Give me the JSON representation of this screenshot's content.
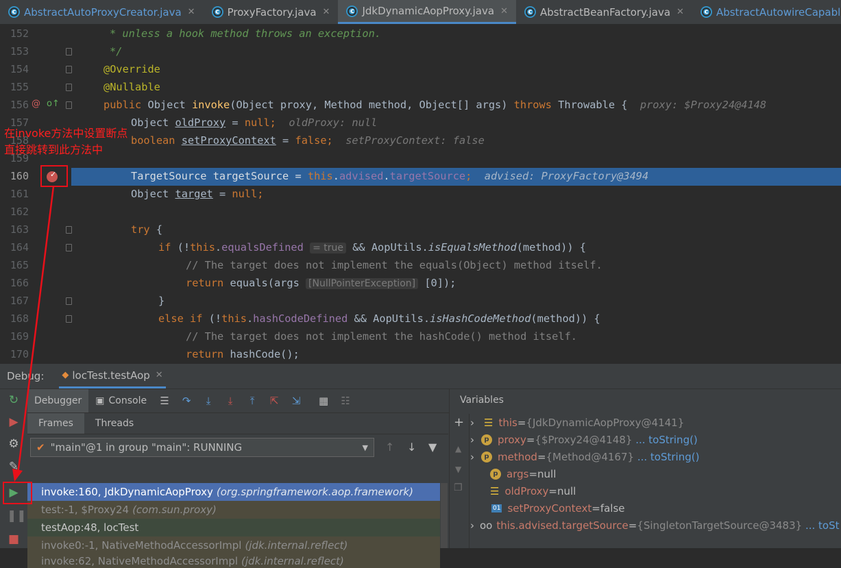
{
  "tabs": [
    {
      "label": "AbstractAutoProxyCreator.java",
      "active": false
    },
    {
      "label": "ProxyFactory.java",
      "active": false
    },
    {
      "label": "JdkDynamicAopProxy.java",
      "active": true
    },
    {
      "label": "AbstractBeanFactory.java",
      "active": false
    },
    {
      "label": "AbstractAutowireCapableBea",
      "active": false
    }
  ],
  "editor": {
    "line_numbers": [
      "152",
      "153",
      "154",
      "155",
      "156",
      "157",
      "158",
      "159",
      "160",
      "161",
      "162",
      "163",
      "164",
      "165",
      "166",
      "167",
      "168",
      "169",
      "170"
    ],
    "current_line": "160",
    "l152": "* unless a hook method throws an exception.",
    "l153": "*/",
    "l154": "@Override",
    "l155": "@Nullable",
    "l156_public": "public",
    "l156_obj": "Object",
    "l156_invoke": "invoke",
    "l156_params": "(Object proxy, Method method, Object[] args)",
    "l156_throws": "throws",
    "l156_throwable": "Throwable {",
    "l156_hint": "proxy: $Proxy24@4148",
    "l157_type": "Object",
    "l157_var": "oldProxy",
    "l157_eq": "=",
    "l157_null": "null",
    "l157_hint": "oldProxy: null",
    "l158_type": "boolean",
    "l158_var": "setProxyContext",
    "l158_false": "false",
    "l158_hint": "setProxyContext: false",
    "l160_a": "TargetSource targetSource = ",
    "l160_this": "this",
    "l160_advised": "advised",
    "l160_ts": "targetSource",
    "l160_hint": "advised: ProxyFactory@3494",
    "l161_type": "Object",
    "l161_var": "target",
    "l161_null": "null",
    "l163_try": "try",
    "l164_if": "if",
    "l164_this": "this",
    "l164_field": "equalsDefined",
    "l164_badge": "= true",
    "l164_rest": "&& AopUtils.",
    "l164_method": "isEqualsMethod",
    "l164_end": "(method)) {",
    "l165": "// The target does not implement the equals(Object) method itself.",
    "l166_return": "return",
    "l166_call": "equals(args",
    "l166_badge": "[NullPointerException]",
    "l166_end": "[0]);",
    "l167": "}",
    "l168_else": "else if",
    "l168_this": "this",
    "l168_field": "hashCodeDefined",
    "l168_rest": "&& AopUtils.",
    "l168_method": "isHashCodeMethod",
    "l168_end": "(method)) {",
    "l169": "// The target does not implement the hashCode() method itself.",
    "l170_return": "return",
    "l170_call": "hashCode();"
  },
  "annotation": {
    "line1": "在invoke方法中设置断点",
    "line2": "直接跳转到此方法中",
    "color": "#ff1f1f"
  },
  "debug": {
    "label": "Debug:",
    "session": "locTest.testAop",
    "tabs": {
      "debugger": "Debugger",
      "console": "Console"
    },
    "frames_tab": "Frames",
    "threads_tab": "Threads",
    "thread": "\"main\"@1 in group \"main\": RUNNING",
    "frames": [
      {
        "method": "invoke:160, JdkDynamicAopProxy",
        "pkg": "(org.springframework.aop.framework)",
        "selected": true
      },
      {
        "method": "test:-1, $Proxy24",
        "pkg": "(com.sun.proxy)",
        "selected": false
      },
      {
        "method": "testAop:48, locTest",
        "pkg": "",
        "selected": false
      },
      {
        "method": "invoke0:-1, NativeMethodAccessorImpl",
        "pkg": "(jdk.internal.reflect)",
        "selected": false
      },
      {
        "method": "invoke:62, NativeMethodAccessorImpl",
        "pkg": "(jdk.internal.reflect)",
        "selected": false
      }
    ],
    "variables_title": "Variables",
    "variables": [
      {
        "name": "this",
        "eq": " = ",
        "value": "{JdkDynamicAopProxy@4141}",
        "link": ""
      },
      {
        "name": "proxy",
        "eq": " = ",
        "value": "{$Proxy24@4148}",
        "link": "... toString()"
      },
      {
        "name": "method",
        "eq": " = ",
        "value": "{Method@4167}",
        "link": "... toString()"
      },
      {
        "name": "args",
        "eq": " = ",
        "value": "null",
        "link": ""
      },
      {
        "name": "oldProxy",
        "eq": " = ",
        "value": "null",
        "link": ""
      },
      {
        "name": "setProxyContext",
        "eq": " = ",
        "value": "false",
        "link": ""
      },
      {
        "name": "this.advised.targetSource",
        "eq": " = ",
        "value": "{SingletonTargetSource@3483}",
        "link": "... toSt"
      }
    ]
  }
}
